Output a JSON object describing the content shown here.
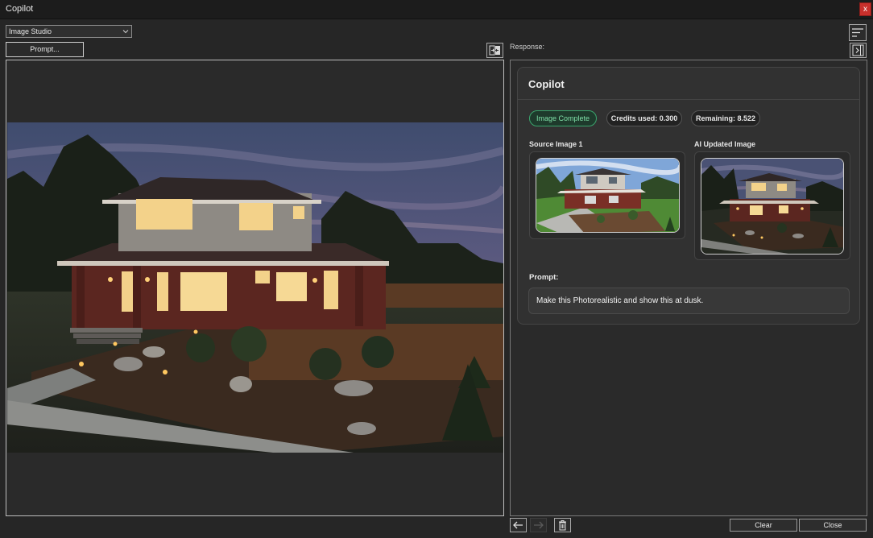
{
  "window": {
    "title": "Copilot",
    "close_glyph": "x"
  },
  "toolbar": {
    "mode_value": "Image Studio",
    "prompt_button": "Prompt..."
  },
  "response": {
    "label": "Response:",
    "card_title": "Copilot",
    "status": "Image Complete",
    "credits_used": "Credits used: 0.300",
    "remaining": "Remaining: 8.522",
    "source_label": "Source Image 1",
    "ai_label": "AI Updated Image",
    "prompt_label": "Prompt:",
    "prompt_text": "Make this Photorealistic and show this at dusk."
  },
  "footer": {
    "clear_label": "Clear",
    "close_label": "Close"
  },
  "icons": {
    "dropdown": "chevron-down-icon",
    "swap": "swap-panels-icon",
    "menu": "hamburger-menu-icon",
    "panel": "collapse-panel-icon",
    "back": "arrow-left-icon",
    "forward": "arrow-right-icon",
    "delete": "trash-icon"
  },
  "colors": {
    "background": "#262626",
    "status_green": "#3aa56d",
    "close_red": "#c9302c"
  }
}
